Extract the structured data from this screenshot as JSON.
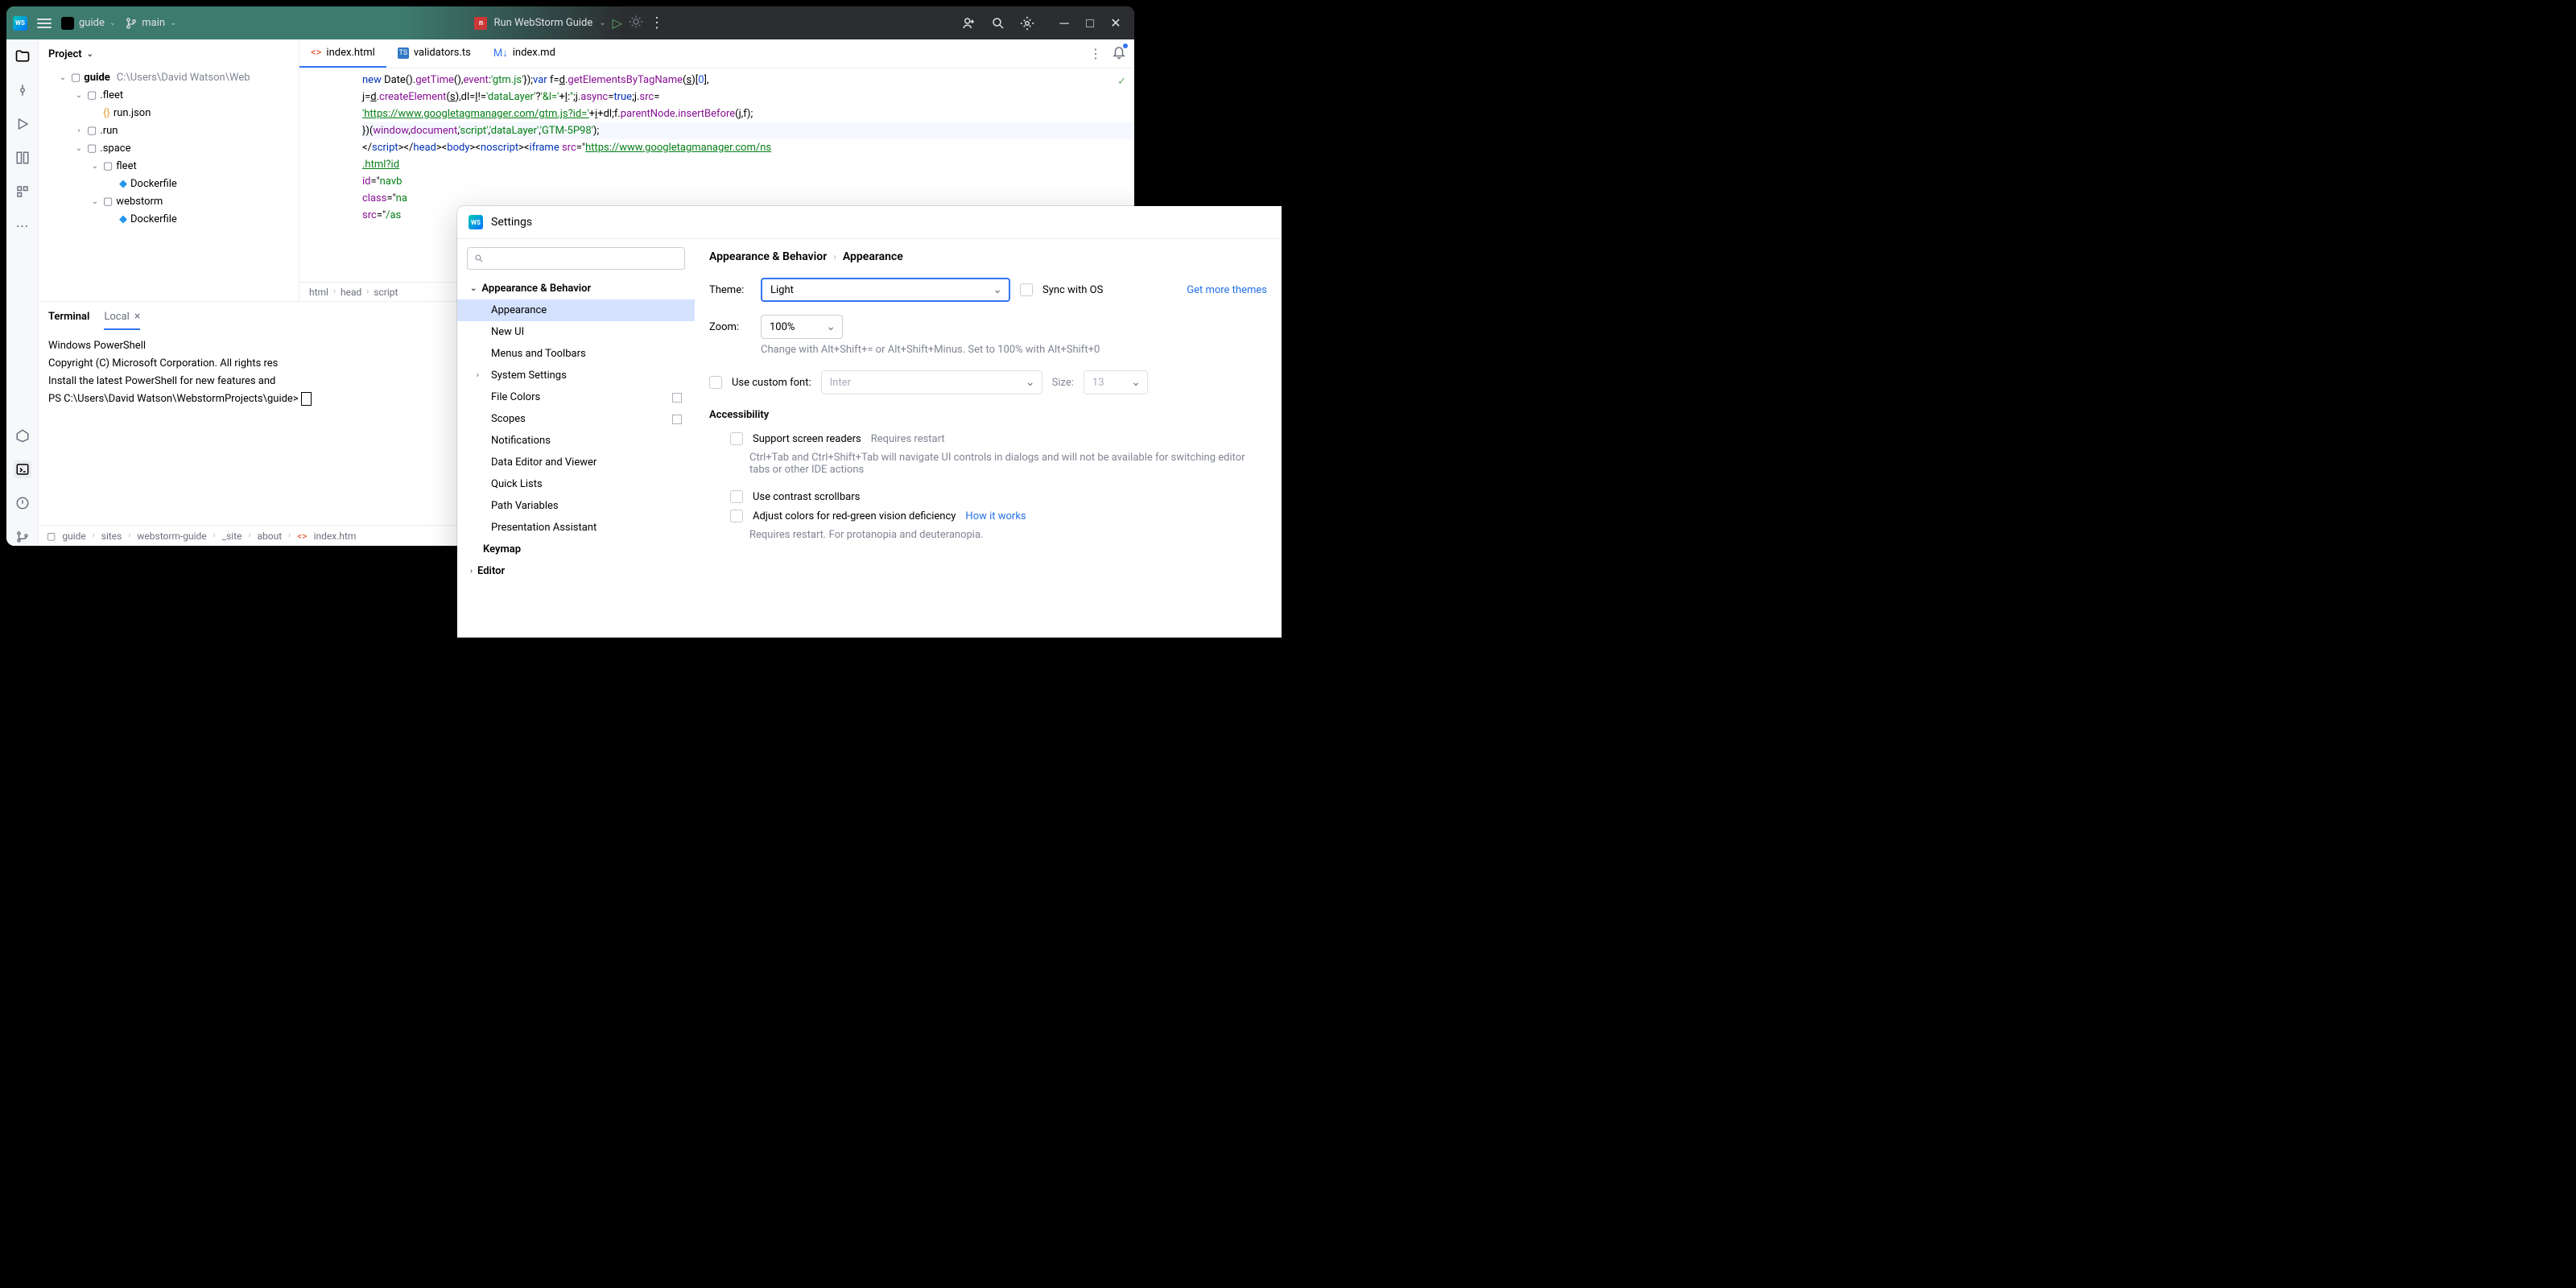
{
  "titlebar": {
    "project": "guide",
    "branch": "main",
    "runconfig": "Run WebStorm Guide"
  },
  "project_panel": {
    "title": "Project",
    "rootName": "guide",
    "rootPath": "C:\\Users\\David Watson\\Web",
    "nodes": [
      {
        "name": ".fleet",
        "indent": 2,
        "expanded": true,
        "type": "folder"
      },
      {
        "name": "run.json",
        "indent": 3,
        "type": "json"
      },
      {
        "name": ".run",
        "indent": 2,
        "expanded": false,
        "type": "folder"
      },
      {
        "name": ".space",
        "indent": 2,
        "expanded": true,
        "type": "folder"
      },
      {
        "name": "fleet",
        "indent": 3,
        "expanded": true,
        "type": "folder"
      },
      {
        "name": "Dockerfile",
        "indent": 4,
        "type": "docker"
      },
      {
        "name": "webstorm",
        "indent": 3,
        "expanded": true,
        "type": "folder"
      },
      {
        "name": "Dockerfile",
        "indent": 4,
        "type": "docker"
      }
    ]
  },
  "tabs": [
    {
      "name": "index.html",
      "type": "html",
      "active": true
    },
    {
      "name": "validators.ts",
      "type": "ts"
    },
    {
      "name": "index.md",
      "type": "md"
    }
  ],
  "code": {
    "l1a": "new",
    "l1b": " Date",
    "l1c": "().",
    "l1d": "getTime",
    "l1e": "(),",
    "l1f": "event",
    "l1g": ":",
    "l1h": "'gtm.js'",
    "l1i": "});",
    "l1j": "var",
    "l1k": " f=",
    "l1l": "d",
    "l1m": ".",
    "l1n": "getElementsByTagName",
    "l1o": "(",
    "l1p": "s",
    "l1q": ")[",
    "l1r": "0",
    "l1s": "],",
    "l2a": "j=",
    "l2b": "d",
    "l2c": ".",
    "l2d": "createElement",
    "l2e": "(",
    "l2f": "s",
    "l2g": "),dl=",
    "l2h": "l",
    "l2i": "!=",
    "l2j": "'dataLayer'",
    "l2k": "?",
    "l2l": "'&l='",
    "l2m": "+",
    "l2n": "l",
    "l2o": ":",
    "l2p": "''",
    "l2q": ";j.",
    "l2r": "async",
    "l2s": "=",
    "l2t": "true",
    "l2u": ";j.",
    "l2v": "src",
    "l2w": "=",
    "l3a": "'https://www.googletagmanager.com/gtm.js?id='",
    "l3b": "+",
    "l3c": "i",
    "l3d": "+dl;f.",
    "l3e": "parentNode",
    "l3f": ".",
    "l3g": "insertBefore",
    "l3h": "(j,f);",
    "l4a": "})(",
    "l4b": "window",
    "l4c": ",",
    "l4d": "document",
    "l4e": ",",
    "l4f": "'script'",
    "l4g": ",",
    "l4h": "'dataLayer'",
    "l4i": ",",
    "l4j": "'GTM-5P98'",
    "l4k": ");",
    "l5a": "</",
    "l5b": "script",
    "l5c": "></",
    "l5d": "head",
    "l5e": "><",
    "l5f": "body",
    "l5g": "><",
    "l5h": "noscript",
    "l5i": "><",
    "l5j": "iframe ",
    "l5k": "src",
    "l5l": "=\"",
    "l5m": "https://www.googletagmanager.com/ns",
    "l6": ".html?id",
    "l7a": "id",
    "l7b": "=\"",
    "l7c": "navb",
    "l8a": "class",
    "l8b": "=\"",
    "l8c": "na",
    "l9a": "src",
    "l9b": "=\"",
    "l9c": "/as"
  },
  "breadcrumb_editor": [
    "html",
    "head",
    "script"
  ],
  "terminal": {
    "tabs": [
      "Terminal",
      "Local"
    ],
    "lines": [
      "Windows PowerShell",
      "Copyright (C) Microsoft Corporation. All rights res",
      "",
      "Install the latest PowerShell for new features and ",
      "",
      "PS C:\\Users\\David Watson\\WebstormProjects\\guide> "
    ]
  },
  "statusbar": {
    "path": [
      "guide",
      "sites",
      "webstorm-guide",
      "_site",
      "about",
      "index.htm"
    ]
  },
  "settings": {
    "title": "Settings",
    "categories": {
      "appearance_behavior": "Appearance & Behavior",
      "items": [
        "Appearance",
        "New UI",
        "Menus and Toolbars",
        "System Settings",
        "File Colors",
        "Scopes",
        "Notifications",
        "Data Editor and Viewer",
        "Quick Lists",
        "Path Variables",
        "Presentation Assistant"
      ],
      "keymap": "Keymap",
      "editor": "Editor"
    },
    "crumb1": "Appearance & Behavior",
    "crumb2": "Appearance",
    "theme_label": "Theme:",
    "theme_value": "Light",
    "sync_os": "Sync with OS",
    "get_themes": "Get more themes",
    "zoom_label": "Zoom:",
    "zoom_value": "100%",
    "zoom_hint": "Change with Alt+Shift+= or Alt+Shift+Minus. Set to 100% with Alt+Shift+0",
    "custom_font_label": "Use custom font:",
    "custom_font_value": "Inter",
    "size_label": "Size:",
    "size_value": "13",
    "accessibility": "Accessibility",
    "screen_readers": "Support screen readers",
    "requires_restart": "Requires restart",
    "sr_hint": "Ctrl+Tab and Ctrl+Shift+Tab will navigate UI controls in dialogs and will not be available for switching editor tabs or other IDE actions",
    "contrast": "Use contrast scrollbars",
    "colorblind": "Adjust colors for red-green vision deficiency",
    "how_works": "How it works",
    "cb_hint": "Requires restart. For protanopia and deuteranopia."
  }
}
